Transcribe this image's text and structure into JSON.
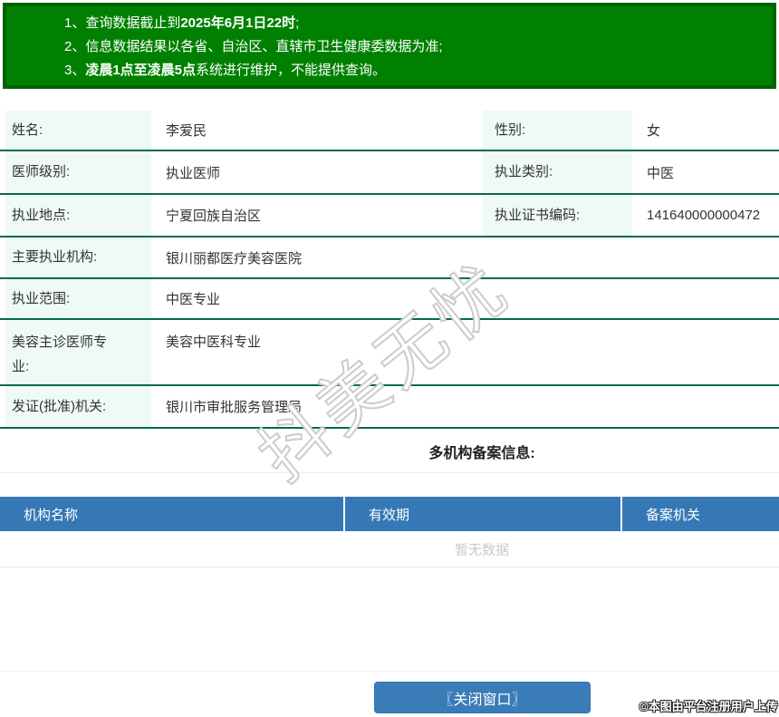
{
  "notice": {
    "line1": {
      "pre": "1、查询数据截止到",
      "bold": "2025年6月1日22时",
      "post": ";"
    },
    "line2": {
      "pre": "2、信息数据结果以各省、自治区、直辖市卫生健康委数据为准;",
      "bold": "",
      "post": ""
    },
    "line3": {
      "pre": "3、",
      "bold": "凌晨1点至凌晨5点",
      "post": "系统进行维护，不能提供查询。"
    }
  },
  "details": {
    "rows2col": [
      {
        "label1": "姓名:",
        "value1": "李爱民",
        "label2": "性别:",
        "value2": "女"
      },
      {
        "label1": "医师级别:",
        "value1": "执业医师",
        "label2": "执业类别:",
        "value2": "中医"
      },
      {
        "label1": "执业地点:",
        "value1": "宁夏回族自治区",
        "label2": "执业证书编码:",
        "value2": "141640000000472"
      }
    ],
    "rows1col": [
      {
        "label": "主要执业机构:",
        "value": "银川丽都医疗美容医院"
      },
      {
        "label": "执业范围:",
        "value": "中医专业"
      },
      {
        "label": "美容主诊医师专业:",
        "value": "美容中医科专业"
      },
      {
        "label": "发证(批准)机关:",
        "value": "银川市审批服务管理局"
      }
    ]
  },
  "filing": {
    "title": "多机构备案信息:",
    "headers": [
      "机构名称",
      "有效期",
      "备案机关"
    ],
    "empty_text": "暂无数据"
  },
  "footer": {
    "close_button": "〖关闭窗口〗"
  },
  "watermarks": {
    "diagonal": "抖美无忧",
    "copyright": "©本图由平台注册用户上传"
  },
  "colors": {
    "banner_bg": "#008000",
    "banner_border": "#006400",
    "row_divider": "#076a4e",
    "label_bg": "#eefaf3",
    "table_header_bg": "#3578b5",
    "button_bg": "#3a7cb8",
    "empty_text": "#c9c9c9"
  }
}
